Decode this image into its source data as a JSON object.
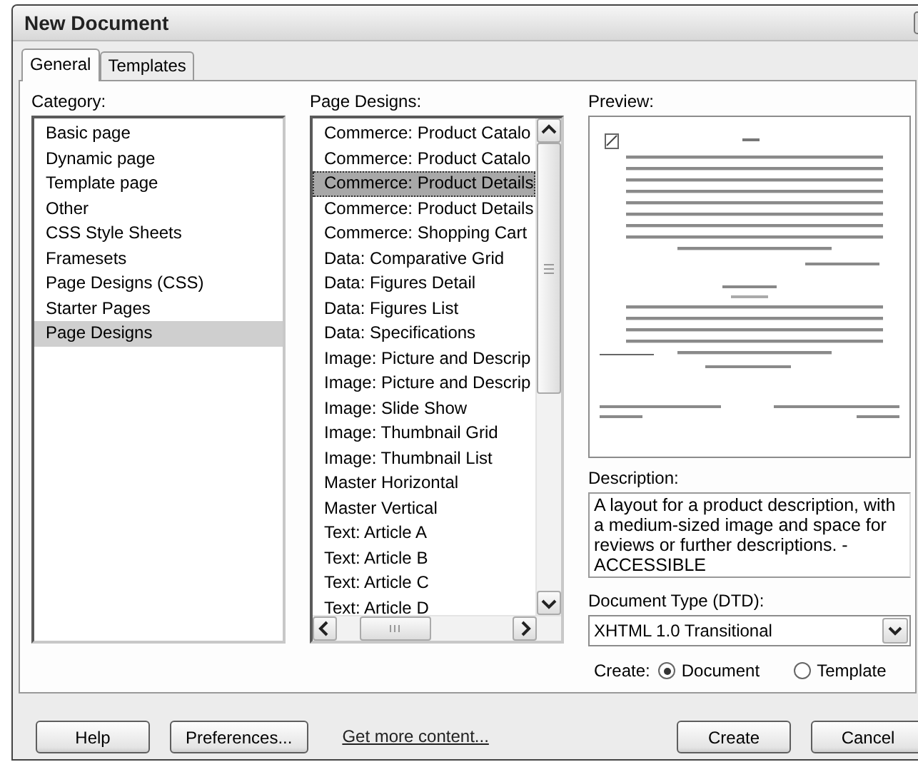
{
  "window": {
    "title": "New Document"
  },
  "tabs": [
    {
      "label": "General",
      "selected": true
    },
    {
      "label": "Templates",
      "selected": false
    }
  ],
  "category": {
    "label": "Category:",
    "items": [
      {
        "label": "Basic page",
        "selected": false
      },
      {
        "label": "Dynamic page",
        "selected": false
      },
      {
        "label": "Template page",
        "selected": false
      },
      {
        "label": "Other",
        "selected": false
      },
      {
        "label": "CSS Style Sheets",
        "selected": false
      },
      {
        "label": "Framesets",
        "selected": false
      },
      {
        "label": "Page Designs (CSS)",
        "selected": false
      },
      {
        "label": "Starter Pages",
        "selected": false
      },
      {
        "label": "Page Designs",
        "selected": true
      }
    ]
  },
  "page_designs": {
    "label": "Page Designs:",
    "items": [
      {
        "label": "Commerce: Product Catalo",
        "selected": false
      },
      {
        "label": "Commerce: Product Catalo",
        "selected": false
      },
      {
        "label": "Commerce: Product Details",
        "selected": true
      },
      {
        "label": "Commerce: Product Details",
        "selected": false
      },
      {
        "label": "Commerce: Shopping Cart",
        "selected": false
      },
      {
        "label": "Data: Comparative Grid",
        "selected": false
      },
      {
        "label": "Data: Figures Detail",
        "selected": false
      },
      {
        "label": "Data: Figures List",
        "selected": false
      },
      {
        "label": "Data: Specifications",
        "selected": false
      },
      {
        "label": "Image: Picture and Descrip",
        "selected": false
      },
      {
        "label": "Image: Picture and Descrip",
        "selected": false
      },
      {
        "label": "Image: Slide Show",
        "selected": false
      },
      {
        "label": "Image: Thumbnail Grid",
        "selected": false
      },
      {
        "label": "Image: Thumbnail List",
        "selected": false
      },
      {
        "label": "Master Horizontal",
        "selected": false
      },
      {
        "label": "Master Vertical",
        "selected": false
      },
      {
        "label": "Text: Article A",
        "selected": false
      },
      {
        "label": "Text: Article B",
        "selected": false
      },
      {
        "label": "Text: Article C",
        "selected": false
      },
      {
        "label": "Text: Article D",
        "selected": false
      }
    ]
  },
  "preview": {
    "label": "Preview:"
  },
  "description": {
    "label": "Description:",
    "text": "A layout for a product description, with a medium-sized image and space for reviews or further descriptions. - ACCESSIBLE"
  },
  "document_type": {
    "label": "Document Type (DTD):",
    "value": "XHTML 1.0 Transitional"
  },
  "create": {
    "label": "Create:",
    "options": [
      {
        "label": "Document",
        "selected": true
      },
      {
        "label": "Template",
        "selected": false
      }
    ]
  },
  "buttons": [
    {
      "label": "Help",
      "kind": "button"
    },
    {
      "label": "Preferences...",
      "kind": "button"
    },
    {
      "label": "Get more content...",
      "kind": "link"
    },
    {
      "label": "Create",
      "kind": "button"
    },
    {
      "label": "Cancel",
      "kind": "button"
    }
  ]
}
